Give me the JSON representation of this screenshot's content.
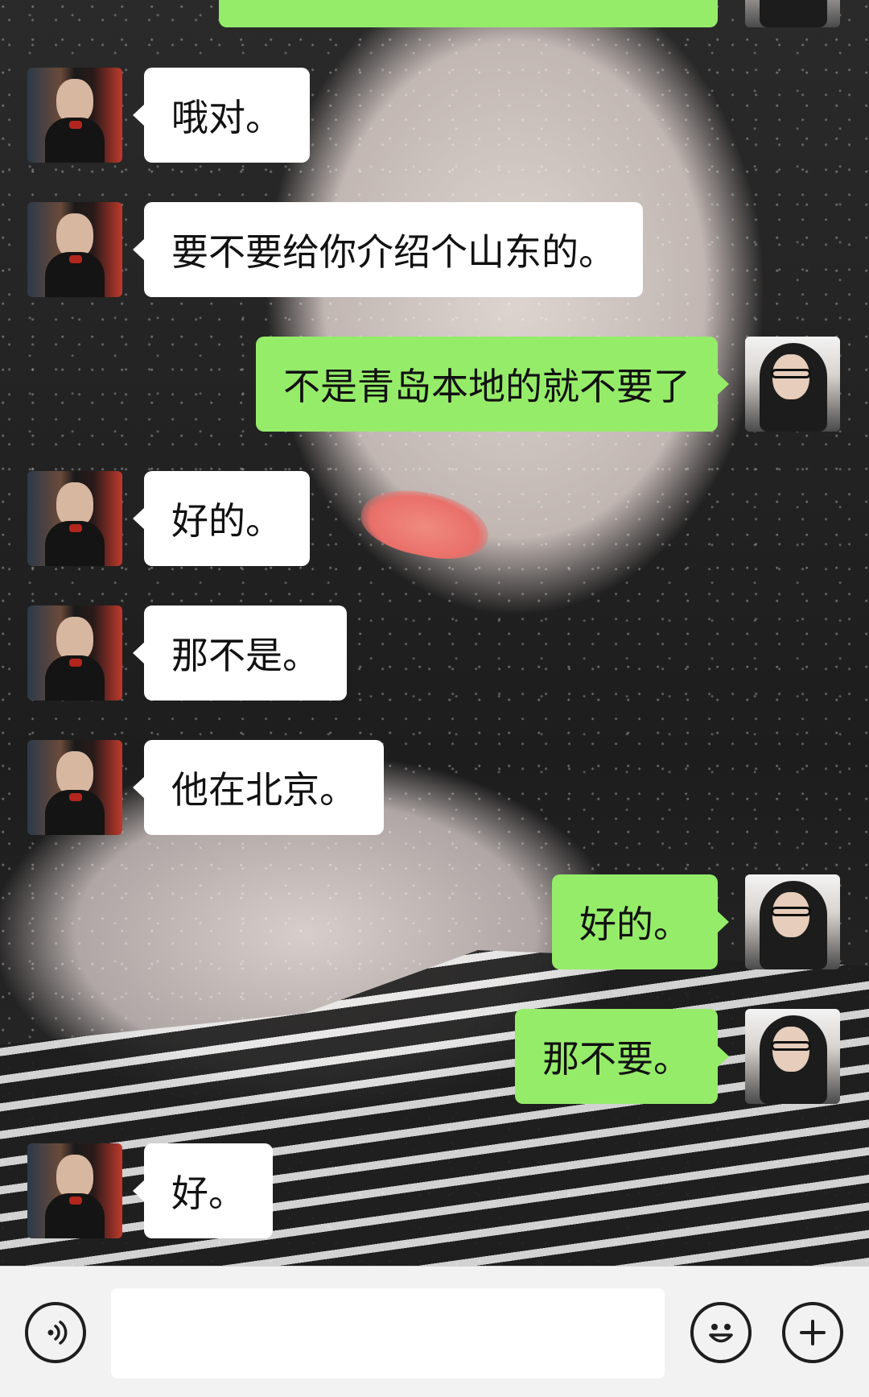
{
  "messages": [
    {
      "side": "right",
      "text": ""
    },
    {
      "side": "left",
      "text": "哦对。"
    },
    {
      "side": "left",
      "text": "要不要给你介绍个山东的。"
    },
    {
      "side": "right",
      "text": "不是青岛本地的就不要了"
    },
    {
      "side": "left",
      "text": "好的。"
    },
    {
      "side": "left",
      "text": "那不是。"
    },
    {
      "side": "left",
      "text": "他在北京。"
    },
    {
      "side": "right",
      "text": "好的。"
    },
    {
      "side": "right",
      "text": "那不要。"
    },
    {
      "side": "left",
      "text": "好。"
    }
  ],
  "input_bar": {
    "voice_icon": "voice-icon",
    "message_value": "",
    "emoji_icon": "emoji-icon",
    "add_icon": "plus-icon"
  },
  "colors": {
    "outgoing_bubble": "#95ec69",
    "incoming_bubble": "#ffffff",
    "input_bar_bg": "#f2f2f2"
  }
}
